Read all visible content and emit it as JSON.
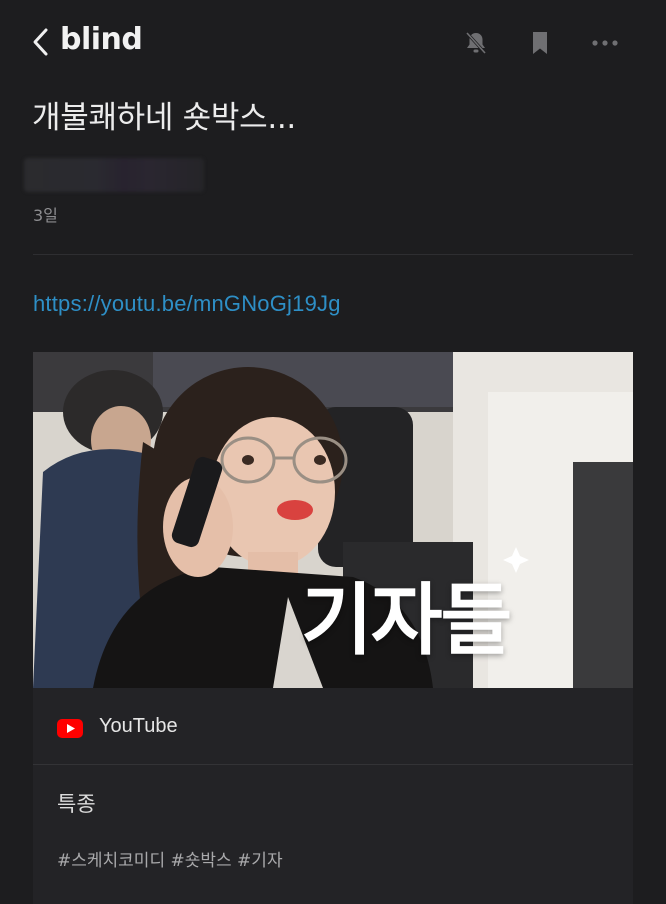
{
  "header": {
    "logo": "blind",
    "back_icon": "chevron-left-icon",
    "mute_icon": "bell-off-icon",
    "bookmark_icon": "bookmark-icon",
    "more_icon": "more-horizontal-icon"
  },
  "post": {
    "title": "개불쾌하네 숏박스...",
    "date": "3일",
    "link": "https://youtu.be/mnGNoGj19Jg"
  },
  "embed": {
    "thumbnail_caption": "기자들",
    "source": "YouTube",
    "source_icon": "youtube-icon",
    "video_title": "특종",
    "tags": "#스케치코미디 #숏박스 #기자"
  },
  "colors": {
    "background": "#1d1d1f",
    "link": "#2e8fc6",
    "youtube_red": "#ff0000"
  }
}
